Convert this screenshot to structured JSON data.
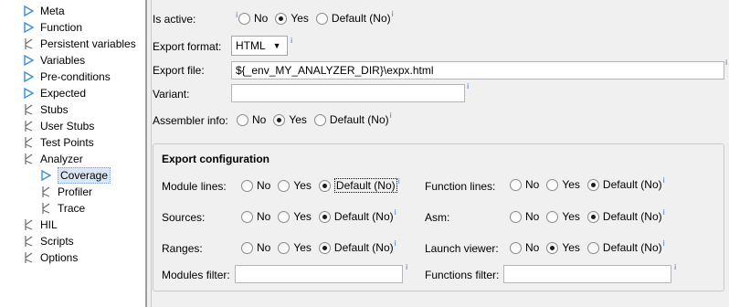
{
  "tree": {
    "items": [
      {
        "label": "Meta",
        "icon": "triangle-right-icon",
        "level": 0
      },
      {
        "label": "Function",
        "icon": "triangle-right-icon",
        "level": 0
      },
      {
        "label": "Persistent variables",
        "icon": "branch-icon",
        "level": 0
      },
      {
        "label": "Variables",
        "icon": "triangle-right-icon",
        "level": 0
      },
      {
        "label": "Pre-conditions",
        "icon": "triangle-right-icon",
        "level": 0
      },
      {
        "label": "Expected",
        "icon": "triangle-right-icon",
        "level": 0
      },
      {
        "label": "Stubs",
        "icon": "branch-icon",
        "level": 0
      },
      {
        "label": "User Stubs",
        "icon": "branch-icon",
        "level": 0
      },
      {
        "label": "Test Points",
        "icon": "branch-icon",
        "level": 0
      },
      {
        "label": "Analyzer",
        "icon": "branch-icon",
        "level": 0
      },
      {
        "label": "Coverage",
        "icon": "triangle-right-icon",
        "level": 1,
        "selected": true
      },
      {
        "label": "Profiler",
        "icon": "branch-icon",
        "level": 1
      },
      {
        "label": "Trace",
        "icon": "branch-icon",
        "level": 1
      },
      {
        "label": "HIL",
        "icon": "branch-icon",
        "level": 0
      },
      {
        "label": "Scripts",
        "icon": "branch-icon",
        "level": 0
      },
      {
        "label": "Options",
        "icon": "branch-icon",
        "level": 0
      }
    ]
  },
  "form": {
    "is_active": {
      "label": "Is active:",
      "options": [
        "No",
        "Yes",
        "Default (No)"
      ],
      "selected": "Yes"
    },
    "export_format": {
      "label": "Export format:",
      "value": "HTML"
    },
    "export_file": {
      "label": "Export file:",
      "value": "${_env_MY_ANALYZER_DIR}\\expx.html"
    },
    "variant": {
      "label": "Variant:",
      "value": ""
    },
    "assembler_info": {
      "label": "Assembler info:",
      "options": [
        "No",
        "Yes",
        "Default (No)"
      ],
      "selected": "Yes"
    }
  },
  "export_config": {
    "title": "Export configuration",
    "module_lines": {
      "label": "Module lines:",
      "options": [
        "No",
        "Yes",
        "Default (No)"
      ],
      "selected": "Default (No)"
    },
    "function_lines": {
      "label": "Function lines:",
      "options": [
        "No",
        "Yes",
        "Default (No)"
      ],
      "selected": "Default (No)"
    },
    "sources": {
      "label": "Sources:",
      "options": [
        "No",
        "Yes",
        "Default (No)"
      ],
      "selected": "Default (No)"
    },
    "asm": {
      "label": "Asm:",
      "options": [
        "No",
        "Yes",
        "Default (No)"
      ],
      "selected": "Default (No)"
    },
    "ranges": {
      "label": "Ranges:",
      "options": [
        "No",
        "Yes",
        "Default (No)"
      ],
      "selected": "Default (No)"
    },
    "launch_viewer": {
      "label": "Launch viewer:",
      "options": [
        "No",
        "Yes",
        "Default (No)"
      ],
      "selected": "Yes"
    },
    "modules_filter": {
      "label": "Modules filter:",
      "value": ""
    },
    "functions_filter": {
      "label": "Functions filter:",
      "value": ""
    }
  },
  "info_marker": "i",
  "colors": {
    "tree_icon_blue": "#3a8fd8",
    "panel_bg": "#f0f0f0",
    "selection_bg": "#dbe6f4",
    "info_blue": "#2d6cc0"
  }
}
